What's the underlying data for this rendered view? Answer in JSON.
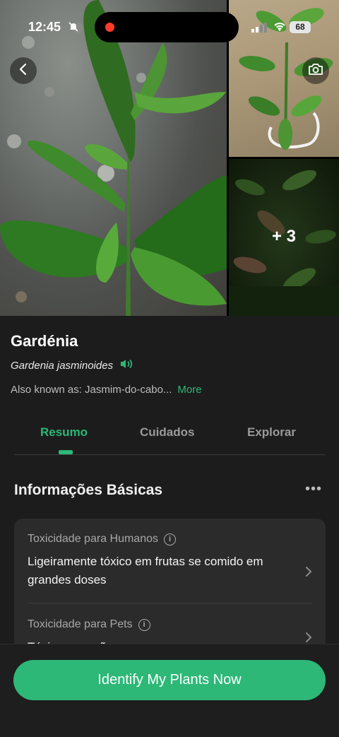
{
  "status_bar": {
    "time": "12:45",
    "battery": "68"
  },
  "gallery": {
    "more_count": "+ 3"
  },
  "plant": {
    "name": "Gardénia",
    "scientific_name": "Gardenia jasminoides",
    "also_known_as": "Also known as: Jasmim-do-cabo...",
    "more_label": "More"
  },
  "tabs": [
    {
      "label": "Resumo",
      "active": true
    },
    {
      "label": "Cuidados",
      "active": false
    },
    {
      "label": "Explorar",
      "active": false
    }
  ],
  "section": {
    "title": "Informações Básicas"
  },
  "info_rows": [
    {
      "label": "Toxicidade para Humanos",
      "value": "Ligeiramente tóxico em frutas se comido em grandes doses"
    },
    {
      "label": "Toxicidade para Pets",
      "value": "Tóxico para cães"
    }
  ],
  "cta": {
    "label": "Identify My Plants Now"
  },
  "colors": {
    "accent": "#2db877",
    "background": "#1c1c1c",
    "card": "#2b2b2b"
  }
}
